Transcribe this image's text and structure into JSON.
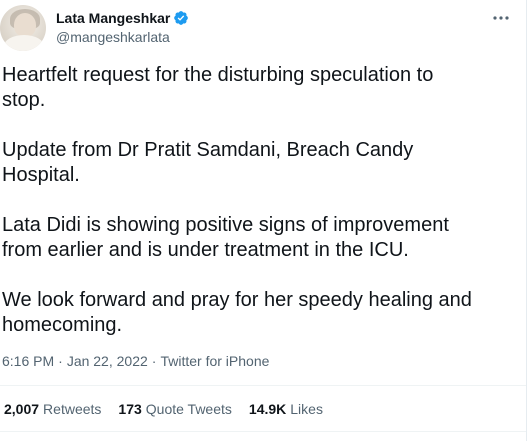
{
  "author": {
    "display_name": "Lata Mangeshkar",
    "handle": "@mangeshkarlata",
    "verified": true,
    "verified_color": "#1d9bf0"
  },
  "tweet": {
    "paragraphs": [
      "Heartfelt request for the disturbing speculation to\nstop.",
      "Update from Dr Pratit Samdani, Breach Candy\nHospital.",
      "Lata Didi is showing positive signs of improvement\nfrom earlier and  is under treatment in the ICU.",
      "We look forward and pray for her speedy healing and\nhomecoming."
    ]
  },
  "meta": {
    "time": "6:16 PM",
    "date": "Jan 22, 2022",
    "separator": "·",
    "source": "Twitter for iPhone"
  },
  "stats": {
    "retweets": {
      "count": "2,007",
      "label": "Retweets"
    },
    "quotes": {
      "count": "173",
      "label": "Quote Tweets"
    },
    "likes": {
      "count": "14.9K",
      "label": "Likes"
    }
  },
  "icons": {
    "verified": "verified-badge-icon",
    "more": "more-options-icon"
  },
  "colors": {
    "text_primary": "#0f1419",
    "text_secondary": "#536471",
    "divider": "#eff3f4"
  }
}
